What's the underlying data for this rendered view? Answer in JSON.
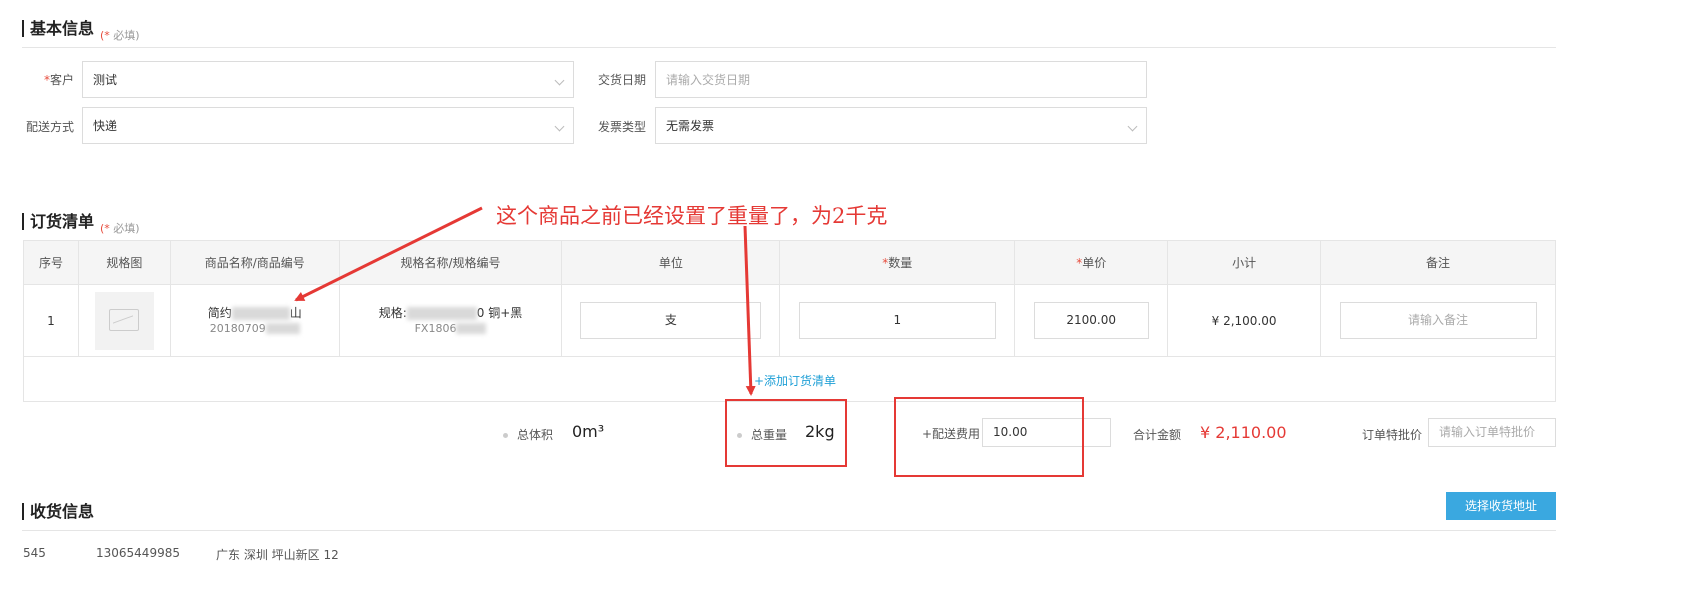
{
  "basic_info": {
    "title": "基本信息",
    "required_note_mark": "(*",
    "required_note_text": "必填)",
    "customer_label": "客户",
    "customer_value": "测试",
    "delivery_date_label": "交货日期",
    "delivery_date_placeholder": "请输入交货日期",
    "shipping_label": "配送方式",
    "shipping_value": "快递",
    "invoice_label": "发票类型",
    "invoice_value": "无需发票"
  },
  "order_list": {
    "title": "订货清单",
    "required_note_mark": "(*",
    "required_note_text": "必填)",
    "columns": [
      "序号",
      "规格图",
      "商品名称/商品编号",
      "规格名称/规格编号",
      "单位",
      "数量",
      "单价",
      "小计",
      "备注"
    ],
    "rows": [
      {
        "index": "1",
        "product_name_prefix": "简约",
        "product_name_suffix": "山",
        "product_code": "20180709",
        "spec_name_prefix": "规格:",
        "spec_name_suffix": "0 铜+黑",
        "spec_code": "FX1806",
        "unit": "支",
        "quantity": "1",
        "unit_price": "2100.00",
        "subtotal": "¥ 2,100.00",
        "remark_placeholder": "请输入备注"
      }
    ],
    "add_link": "+添加订货清单"
  },
  "summary": {
    "volume_label": "总体积",
    "volume_value": "0m³",
    "weight_label": "总重量",
    "weight_value": "2kg",
    "shipping_fee_label": "+配送费用",
    "shipping_fee_value": "10.00",
    "total_label": "合计金额",
    "total_value": "¥ 2,110.00",
    "special_price_label": "订单特批价",
    "special_price_placeholder": "请输入订单特批价"
  },
  "annotation": {
    "text": "这个商品之前已经设置了重量了，为2千克"
  },
  "receiving": {
    "title": "收货信息",
    "select_button": "选择收货地址",
    "id": "545",
    "phone": "13065449985",
    "address": "广东 深圳 坪山新区  12"
  },
  "colors": {
    "required": "#e74c3c",
    "link": "#1e9fd6",
    "button": "#3aa8e0",
    "total": "#e53935",
    "annotation": "#e53935"
  }
}
